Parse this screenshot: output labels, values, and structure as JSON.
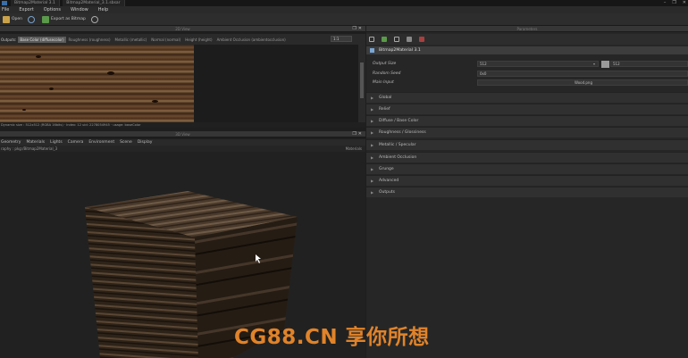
{
  "window": {
    "tabs": [
      "Bitmap2Material 3.1",
      "Bitmap2Material_3.1.sbsar"
    ],
    "controls": [
      "–",
      "❐",
      "✕"
    ]
  },
  "menu": [
    "File",
    "Export",
    "Options",
    "Window",
    "Help"
  ],
  "toolbar": {
    "open": "Open",
    "export": "Export as Bitmap"
  },
  "panels": {
    "view2d": "2D View",
    "view3d": "3D View",
    "params": "Parameters"
  },
  "view2d": {
    "outputs_label": "Outputs:",
    "channels": [
      "Base Color (diffusecolor)",
      "Roughness (roughness)",
      "Metallic (metallic)",
      "Normal (normal)",
      "Height (height)",
      "Ambient Occlusion (ambientocclusion)"
    ],
    "active_channel": 0,
    "zoom": "1:1",
    "status": "Dynamic size : 512x512 (RGBA 16bits) · Index: 12 uid: 2278054945 · usage: baseColor"
  },
  "view3d": {
    "tabs": [
      "Geometry",
      "Materials",
      "Lights",
      "Camera",
      "Environment",
      "Scene",
      "Display"
    ],
    "scene": "raphy : pkg:/Bitmap2Material_3",
    "material": "Materials"
  },
  "params": {
    "graph_title": "Bitmap2Material 3.1",
    "output_size_label": "Output Size",
    "output_size_w": "512",
    "output_size_h": "512",
    "random_seed_label": "Random Seed",
    "random_seed": "0x0",
    "main_input_label": "Main Input",
    "main_input": "Wood.png",
    "sections": [
      "Global",
      "Relief",
      "Diffuse / Base Color",
      "Roughness / Glossiness",
      "Metallic / Specular",
      "Ambient Occlusion",
      "Grunge",
      "Advanced",
      "Outputs"
    ]
  },
  "watermark": "CG88.CN 享你所想",
  "colors": {
    "accent": "#e0832a",
    "panel": "#262626",
    "header": "#363636"
  }
}
